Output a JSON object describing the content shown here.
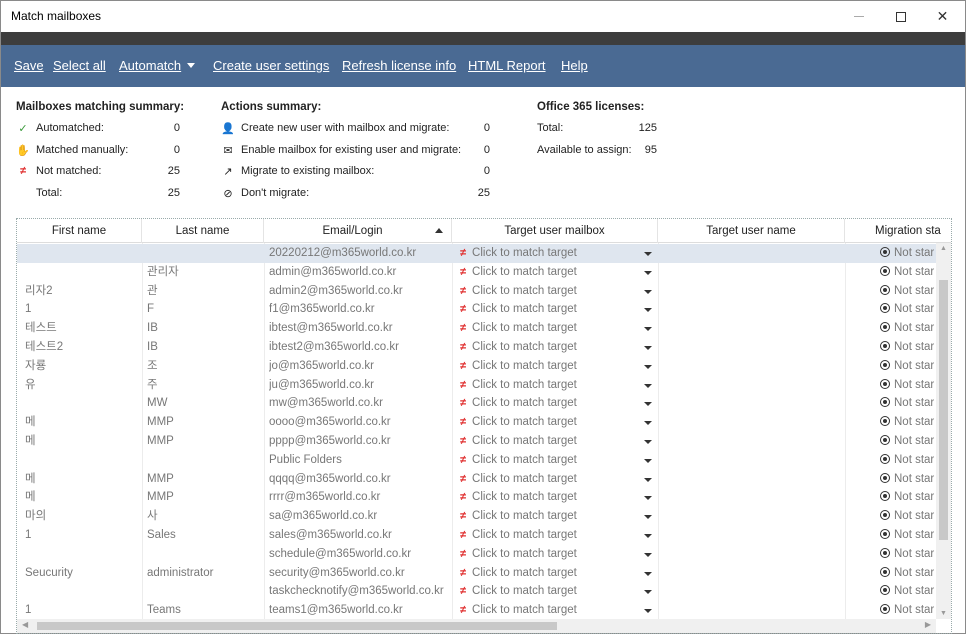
{
  "window": {
    "title": "Match mailboxes"
  },
  "menu": {
    "save": "Save",
    "select_all": "Select all",
    "automatch": "Automatch",
    "create_user_settings": "Create user settings",
    "refresh_license": "Refresh license info",
    "html_report": "HTML Report",
    "help": "Help"
  },
  "matching_summary": {
    "title": "Mailboxes matching summary:",
    "automatched_label": "Automatched:",
    "automatched_value": "0",
    "manual_label": "Matched manually:",
    "manual_value": "0",
    "not_matched_label": "Not matched:",
    "not_matched_value": "25",
    "total_label": "Total:",
    "total_value": "25"
  },
  "actions_summary": {
    "title": "Actions summary:",
    "create_label": "Create new user with mailbox and migrate:",
    "create_value": "0",
    "enable_label": "Enable mailbox for existing user and migrate:",
    "enable_value": "0",
    "migrate_label": "Migrate to existing mailbox:",
    "migrate_value": "0",
    "dont_label": "Don't migrate:",
    "dont_value": "25"
  },
  "licenses": {
    "title": "Office 365 licenses:",
    "total_label": "Total:",
    "total_value": "125",
    "available_label": "Available to assign:",
    "available_value": "95"
  },
  "grid": {
    "headers": {
      "first_name": "First name",
      "last_name": "Last name",
      "email": "Email/Login",
      "target_mailbox": "Target user mailbox",
      "target_user": "Target user name",
      "migration_status": "Migration sta"
    },
    "target_placeholder": "Click to match target",
    "status_text": "Not star",
    "rows": [
      {
        "first": "",
        "last": "",
        "email": "20220212@m365world.co.kr"
      },
      {
        "first": "",
        "last": "관리자",
        "email": "admin@m365world.co.kr"
      },
      {
        "first": "리자2",
        "last": "관",
        "email": "admin2@m365world.co.kr"
      },
      {
        "first": "1",
        "last": "F",
        "email": "f1@m365world.co.kr"
      },
      {
        "first": "테스트",
        "last": "IB",
        "email": "ibtest@m365world.co.kr"
      },
      {
        "first": "테스트2",
        "last": "IB",
        "email": "ibtest2@m365world.co.kr"
      },
      {
        "first": "자룡",
        "last": "조",
        "email": "jo@m365world.co.kr"
      },
      {
        "first": "유",
        "last": "주",
        "email": "ju@m365world.co.kr"
      },
      {
        "first": "",
        "last": "MW",
        "email": "mw@m365world.co.kr"
      },
      {
        "first": "메",
        "last": "MMP",
        "email": "oooo@m365world.co.kr"
      },
      {
        "first": "메",
        "last": "MMP",
        "email": "pppp@m365world.co.kr"
      },
      {
        "first": "",
        "last": "",
        "email": "Public Folders"
      },
      {
        "first": "메",
        "last": "MMP",
        "email": "qqqq@m365world.co.kr"
      },
      {
        "first": "메",
        "last": "MMP",
        "email": "rrrr@m365world.co.kr"
      },
      {
        "first": "마의",
        "last": "사",
        "email": "sa@m365world.co.kr"
      },
      {
        "first": "1",
        "last": "Sales",
        "email": "sales@m365world.co.kr"
      },
      {
        "first": "",
        "last": "",
        "email": "schedule@m365world.co.kr"
      },
      {
        "first": "Seucurity",
        "last": "administrator",
        "email": "security@m365world.co.kr"
      },
      {
        "first": "",
        "last": "",
        "email": "taskchecknotify@m365world.co.kr"
      },
      {
        "first": "1",
        "last": "Teams",
        "email": "teams1@m365world.co.kr"
      }
    ]
  }
}
